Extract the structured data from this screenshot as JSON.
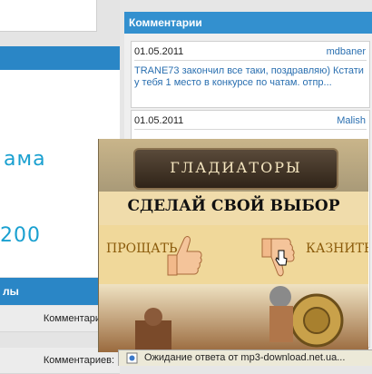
{
  "left": {
    "logo_fragment_1": "ама",
    "logo_fragment_2": "200",
    "section_title": "лы",
    "row_label": "Комментариев:"
  },
  "comments": {
    "header": "Комментарии",
    "items": [
      {
        "date": "01.05.2011",
        "author": "mdbaner",
        "text": "TRANE73 закончил все таки, поздравляю) Кстати у тебя 1 место в конкурсе по чатам. отпр..."
      },
      {
        "date": "01.05.2011",
        "author": "Malish",
        "text": ""
      }
    ]
  },
  "banner": {
    "title": "ГЛАДИАТОРЫ",
    "slogan": "СДЕЛАЙ СВОЙ ВЫБОР",
    "spare_label": "ПРОЩАТЬ",
    "execute_label": "КАЗНИТЬ"
  },
  "status_bar": {
    "text": "Ожидание ответа от mp3-download.net.ua..."
  },
  "colors": {
    "accent_blue": "#3390cf",
    "link_blue": "#2a6fb0",
    "banner_gold": "#f0dcab"
  }
}
